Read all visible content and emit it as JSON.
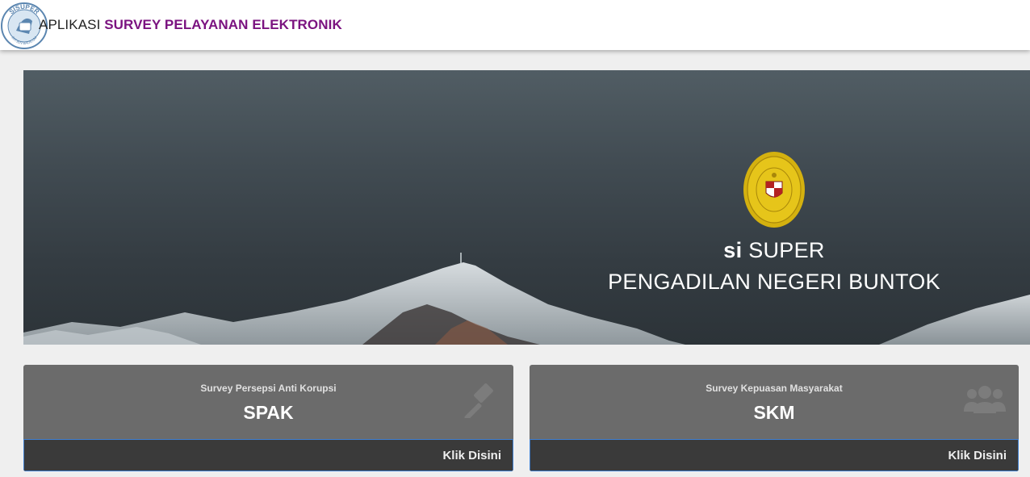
{
  "navbar": {
    "title_part1": "APLIKASI ",
    "title_part2": "SURVEY PELAYANAN ELEKTRONIK",
    "logo_text_top": "SISUPER",
    "logo_text_bottom": "DITJEN BADILUM",
    "title_color": "#7b1380"
  },
  "hero": {
    "line1_bold": "si",
    "line1_rest": " SUPER",
    "line2": "PENGADILAN NEGERI BUNTOK"
  },
  "cards": [
    {
      "subtitle": "Survey Persepsi Anti Korupsi",
      "title": "SPAK",
      "icon": "gavel-icon",
      "link_label": "Klik Disini"
    },
    {
      "subtitle": "Survey Kepuasan Masyarakat",
      "title": "SKM",
      "icon": "users-icon",
      "link_label": "Klik Disini"
    }
  ]
}
